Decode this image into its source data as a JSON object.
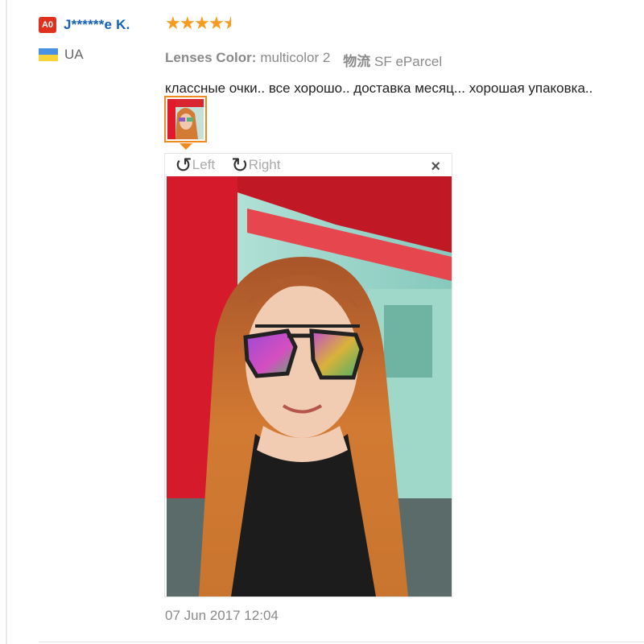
{
  "user": {
    "level_badge": "A0",
    "name": "J******e K.",
    "country": "UA"
  },
  "review": {
    "rating": 4.6,
    "attribute_label": "Lenses Color:",
    "attribute_value": "multicolor 2",
    "shipping_label": "物流",
    "shipping_value": "SF eParcel",
    "text": "классные очки.. все хорошо.. доставка месяц... хорошая упаковка..",
    "timestamp": "07 Jun 2017 12:04"
  },
  "viewer": {
    "rotate_left_label": "Left",
    "rotate_right_label": "Right",
    "close_glyph": "×",
    "rotate_left_glyph": "↺",
    "rotate_right_glyph": "↻"
  },
  "icons": {
    "star": "star-icon",
    "flag": "ukraine-flag-icon",
    "rotate_left": "rotate-left-icon",
    "rotate_right": "rotate-right-icon",
    "close": "close-icon"
  },
  "colors": {
    "accent_orange": "#f08a1e",
    "star": "#f79a1e",
    "link_blue": "#1560b5",
    "badge_red": "#e0301e"
  }
}
